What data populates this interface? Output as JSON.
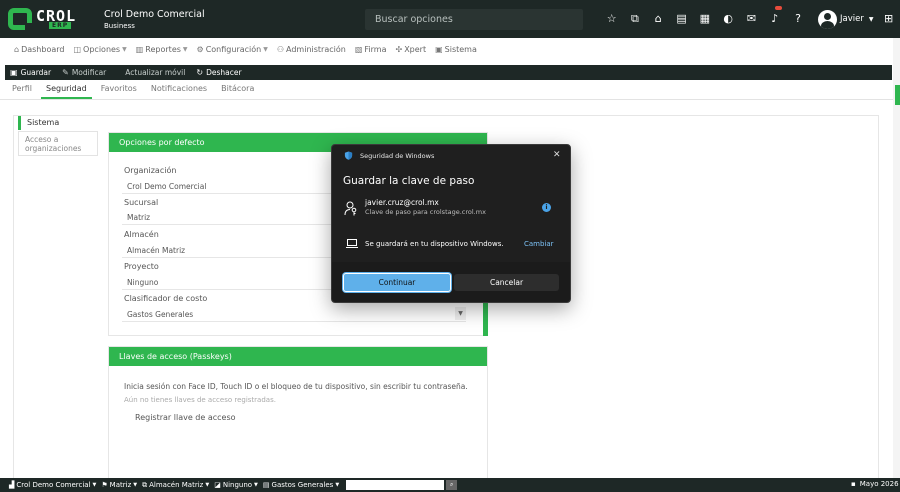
{
  "header": {
    "logo_text": "CROL",
    "logo_sub": "ERP",
    "company_name": "Crol Demo Comercial",
    "company_plan": "Business",
    "search_placeholder": "Buscar opciones",
    "user_name": "Javier",
    "icons": [
      "star-icon",
      "copy-icon",
      "home-icon",
      "document-icon",
      "store-icon",
      "chat-icon",
      "mail-icon",
      "bell-icon",
      "help-icon"
    ]
  },
  "menu": [
    {
      "label": "Dashboard",
      "icon": "dashboard-icon",
      "caret": false
    },
    {
      "label": "Opciones",
      "icon": "options-icon",
      "caret": true
    },
    {
      "label": "Reportes",
      "icon": "reports-icon",
      "caret": true
    },
    {
      "label": "Configuración",
      "icon": "settings-icon",
      "caret": true
    },
    {
      "label": "Administración",
      "icon": "admin-icon",
      "caret": false
    },
    {
      "label": "Firma",
      "icon": "signature-icon",
      "caret": false
    },
    {
      "label": "Xpert",
      "icon": "xpert-icon",
      "caret": false
    },
    {
      "label": "Sistema",
      "icon": "system-icon",
      "caret": false
    }
  ],
  "toolbar": {
    "save": "Guardar",
    "modify": "Modificar",
    "update_mobile": "Actualizar móvil",
    "undo": "Deshacer"
  },
  "tabs": [
    "Perfil",
    "Seguridad",
    "Favoritos",
    "Notificaciones",
    "Bitácora"
  ],
  "active_tab": "Seguridad",
  "sidebar": {
    "active": "Sistema",
    "item": "Acceso a organizaciones"
  },
  "defaults_panel": {
    "title": "Opciones por defecto",
    "fields": [
      {
        "label": "Organización",
        "value": "Crol Demo Comercial"
      },
      {
        "label": "Sucursal",
        "value": "Matriz"
      },
      {
        "label": "Almacén",
        "value": "Almacén Matriz"
      },
      {
        "label": "Proyecto",
        "value": "Ninguno"
      },
      {
        "label": "Clasificador de costo",
        "value": "Gastos Generales"
      }
    ]
  },
  "passkeys_panel": {
    "title": "Llaves de acceso (Passkeys)",
    "description": "Inicia sesión con Face ID, Touch ID o el bloqueo de tu dispositivo, sin escribir tu contraseña.",
    "empty": "Aún no tienes llaves de acceso registradas.",
    "register": "Registrar llave de acceso"
  },
  "dialog": {
    "window_title": "Seguridad de Windows",
    "heading": "Guardar la clave de paso",
    "email": "javier.cruz@crol.mx",
    "subtitle": "Clave de paso para crolstage.crol.mx",
    "save_note": "Se guardará en tu dispositivo Windows.",
    "change": "Cambiar",
    "continue": "Continuar",
    "cancel": "Cancelar"
  },
  "statusbar": {
    "company": "Crol Demo Comercial",
    "branch": "Matriz",
    "warehouse": "Almacén Matriz",
    "project": "Ninguno",
    "cost": "Gastos Generales",
    "date": "Mayo 2026"
  },
  "colors": {
    "brand_green": "#2fb64f",
    "dark": "#1e2826",
    "dialog_bg": "#1f1f1f",
    "accent_blue": "#5fb0ea"
  }
}
